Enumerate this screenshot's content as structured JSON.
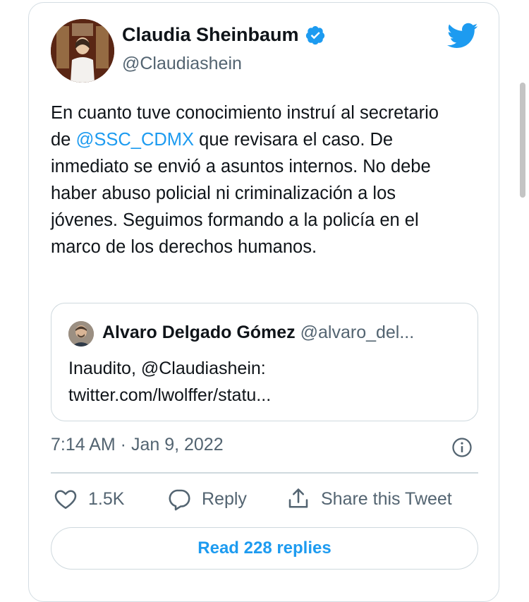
{
  "author": {
    "name": "Claudia Sheinbaum",
    "handle": "@Claudiashein",
    "verified": true
  },
  "tweet": {
    "text_before": "En cuanto tuve conocimiento instruí al secretario de ",
    "mention": "@SSC_CDMX",
    "text_after": " que revisara el caso. De inmediato se envió a asuntos internos. No debe haber abuso policial ni criminalización a los jóvenes. Seguimos formando a la policía en el marco de los derechos humanos."
  },
  "quoted_tweet": {
    "author_name": "Alvaro Delgado Gómez",
    "author_handle": "@alvaro_del...",
    "line1": "Inaudito, @Claudiashein:",
    "line2": "twitter.com/lwolffer/statu..."
  },
  "meta": {
    "timestamp": "7:14 AM · Jan 9, 2022"
  },
  "actions": {
    "like_count": "1.5K",
    "reply_label": "Reply",
    "share_label": "Share this Tweet"
  },
  "read_replies_label": "Read 228 replies",
  "icons": {
    "brand": "twitter-bird-icon",
    "verified": "verified-badge-icon",
    "info": "info-icon",
    "like": "heart-icon",
    "reply": "speech-bubble-icon",
    "share": "share-upload-icon"
  },
  "colors": {
    "accent": "#1d9bf0",
    "text": "#0f1419",
    "secondary": "#536471",
    "border": "#cfd9de"
  }
}
